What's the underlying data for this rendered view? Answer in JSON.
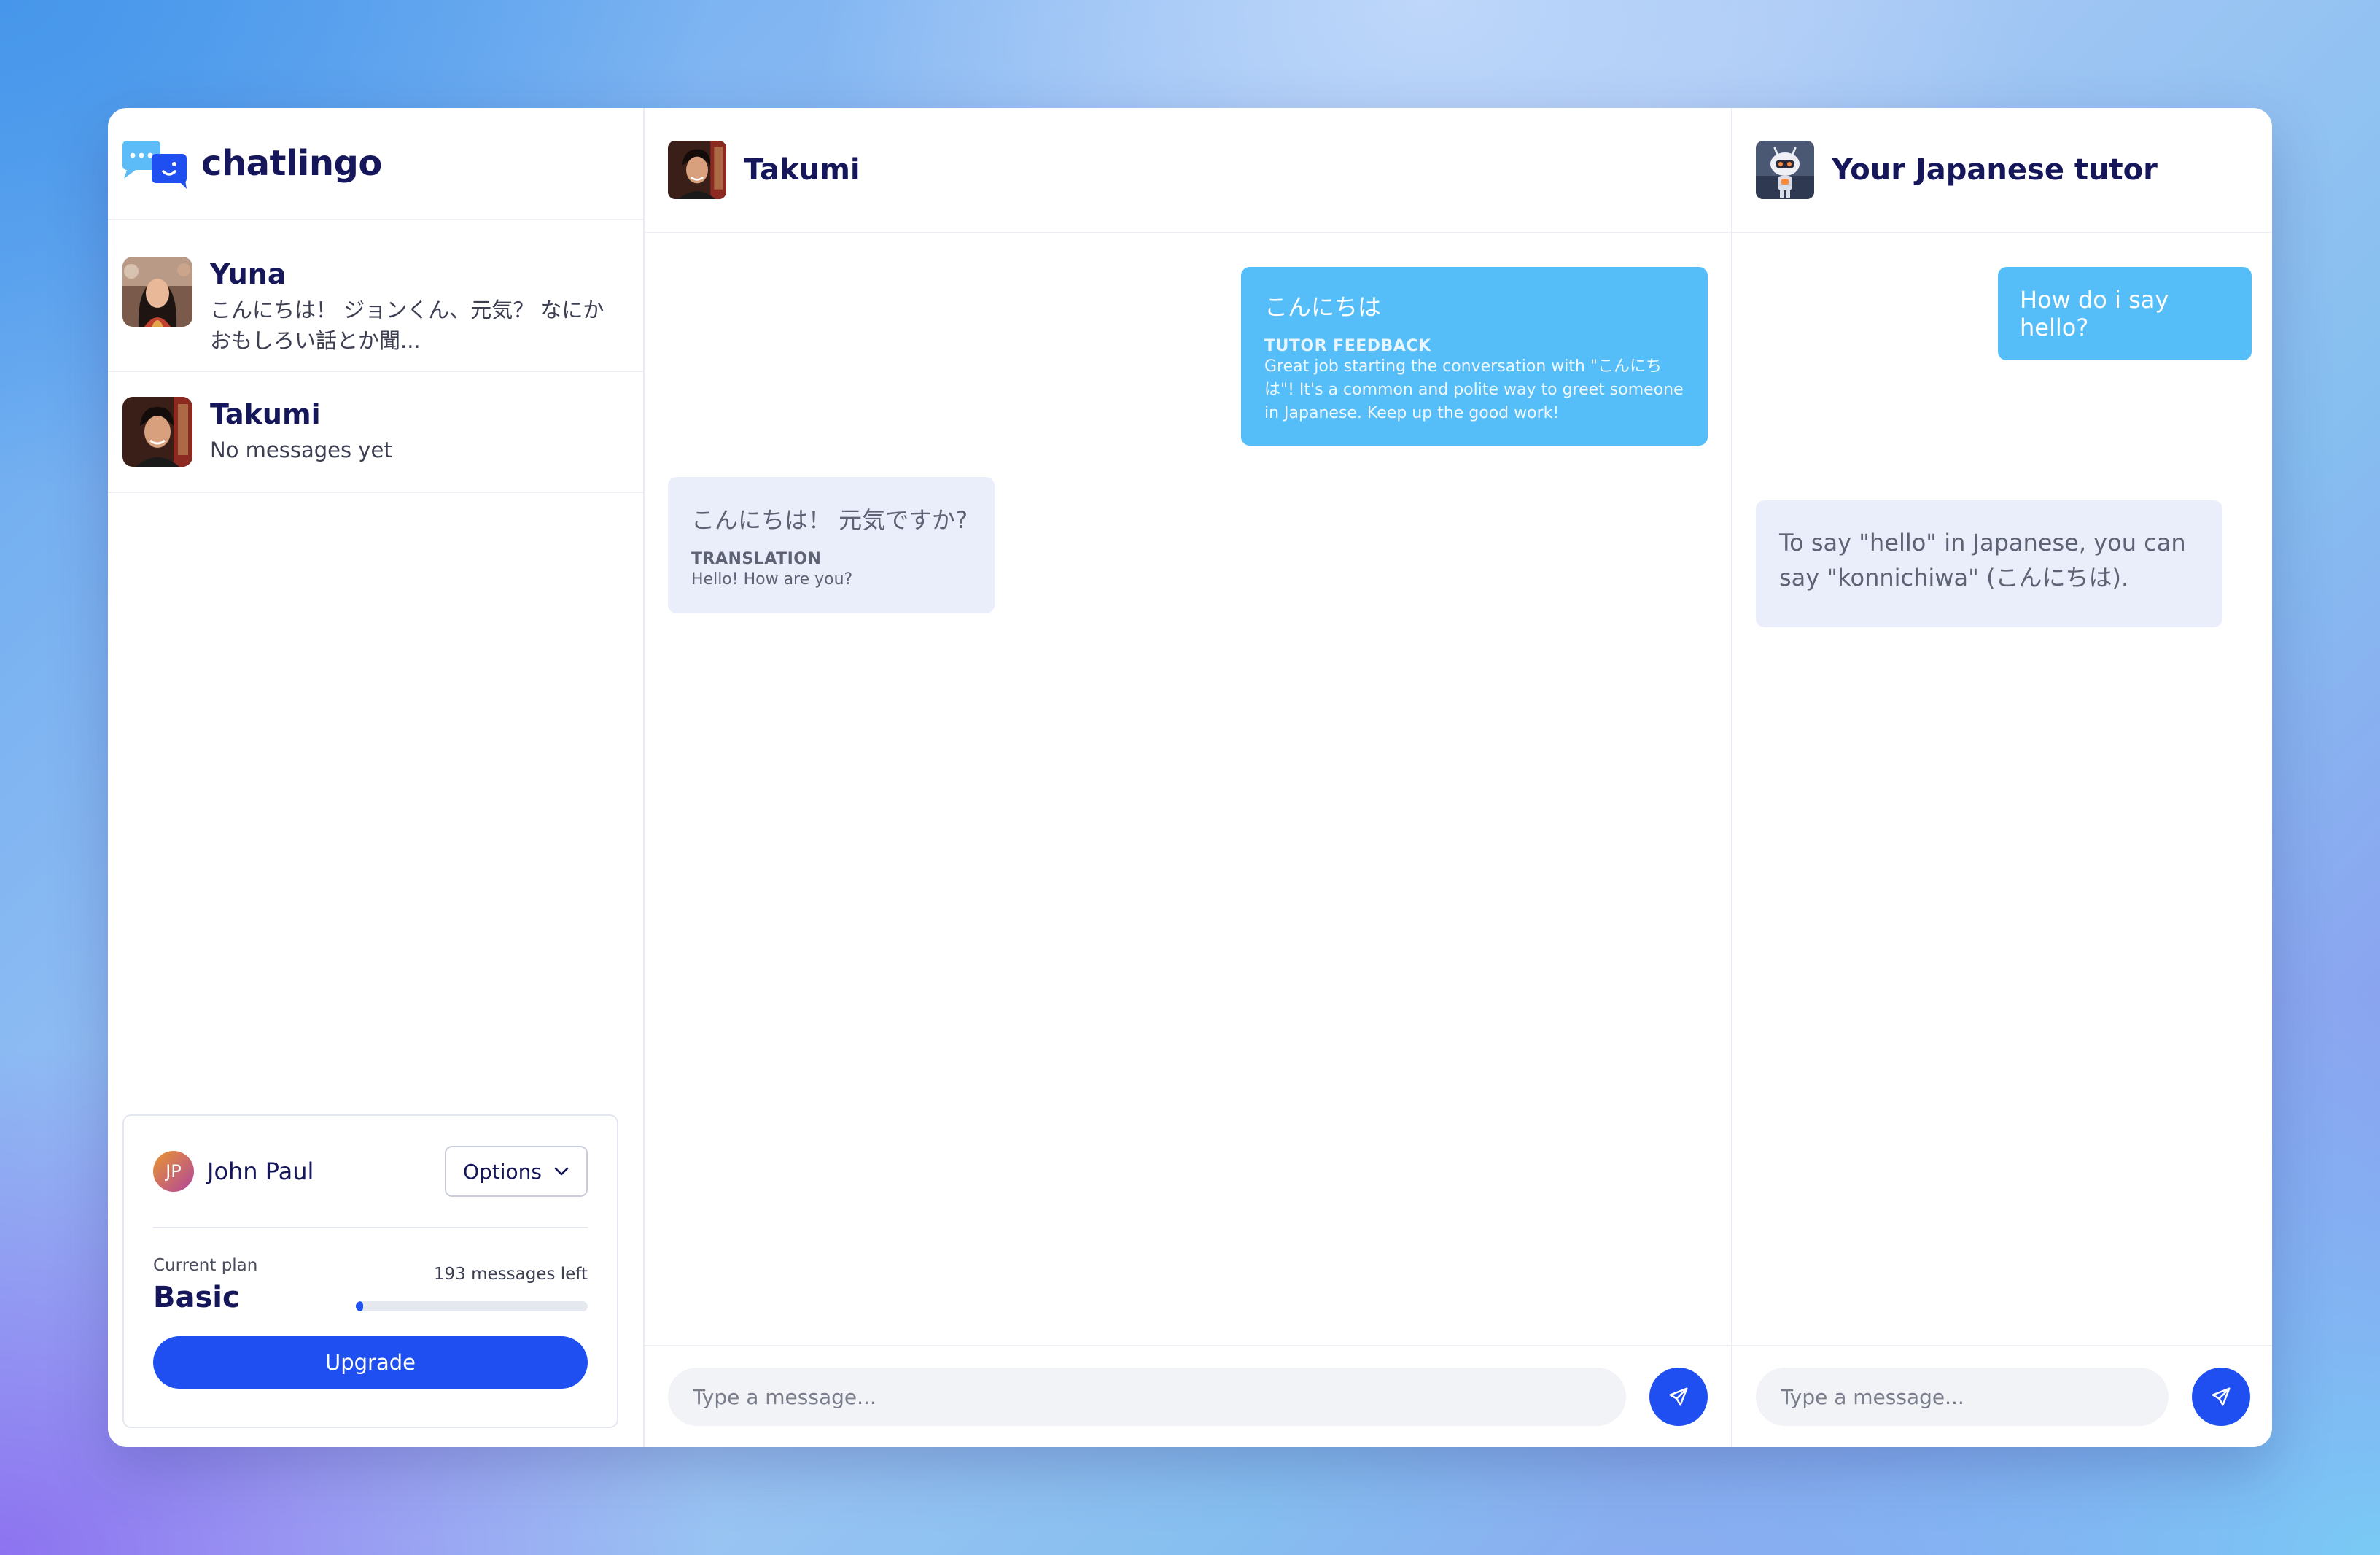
{
  "app": {
    "name": "chatlingo"
  },
  "sidebar": {
    "contacts": [
      {
        "name": "Yuna",
        "preview": "こんにちは！ ジョンくん、元気？ なにかおもしろい話とか聞..."
      },
      {
        "name": "Takumi",
        "preview": "No messages yet"
      }
    ],
    "user": {
      "initials": "JP",
      "name": "John Paul",
      "options_label": "Options"
    },
    "plan": {
      "label": "Current plan",
      "name": "Basic",
      "messages_left": "193 messages left",
      "usage_fraction": 0.03,
      "upgrade_label": "Upgrade"
    }
  },
  "chat": {
    "title": "Takumi",
    "messages": [
      {
        "direction": "out",
        "text": "こんにちは",
        "label": "TUTOR FEEDBACK",
        "sub": "Great job starting the conversation with \"こんにちは\"! It's a common and polite way to greet someone in Japanese. Keep up the good work!"
      },
      {
        "direction": "in",
        "text": "こんにちは！ 元気ですか?",
        "label": "TRANSLATION",
        "sub": "Hello! How are you?"
      }
    ],
    "input_placeholder": "Type a message..."
  },
  "tutor": {
    "title": "Your Japanese tutor",
    "messages": [
      {
        "direction": "out",
        "text": "How do i say hello?"
      },
      {
        "direction": "in",
        "text": "To say \"hello\" in Japanese, you can say \"konnichiwa\" (こんにちは)."
      }
    ],
    "input_placeholder": "Type a message..."
  },
  "colors": {
    "accent": "#1f4ff0",
    "outgoing_bubble": "#55bef8",
    "incoming_bubble": "#eaeefb",
    "heading": "#15175a"
  }
}
